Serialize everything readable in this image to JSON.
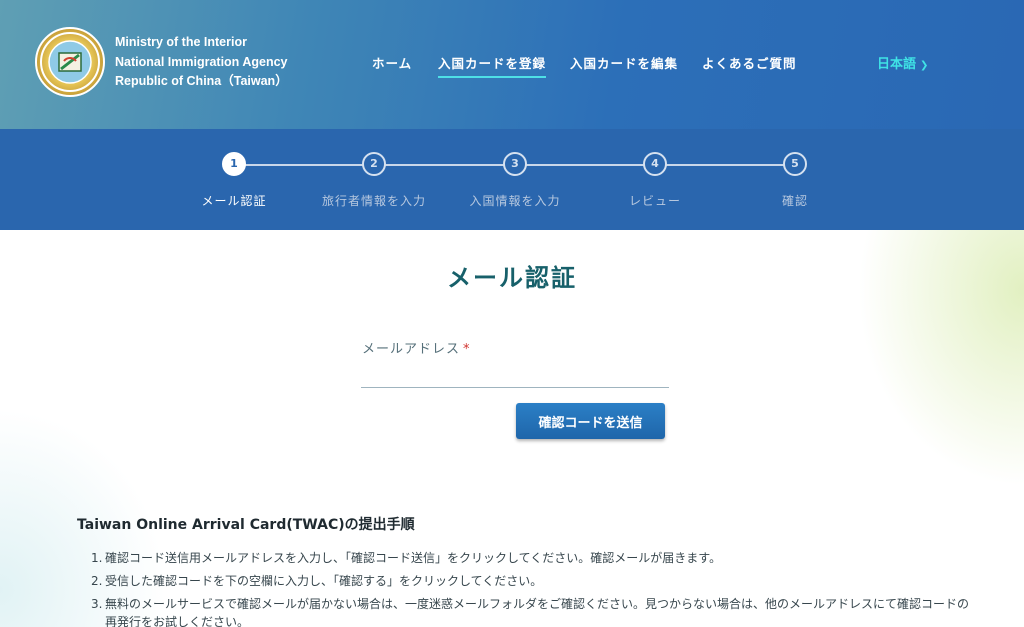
{
  "header": {
    "agency_lines": [
      "Ministry of the Interior",
      "National Immigration Agency",
      "Republic of China（Taiwan）"
    ],
    "nav": [
      {
        "label": "ホーム",
        "active": false
      },
      {
        "label": "入国カードを登録",
        "active": true
      },
      {
        "label": "入国カードを編集",
        "active": false
      },
      {
        "label": "よくあるご質問",
        "active": false
      }
    ],
    "language": "日本語"
  },
  "stepper": {
    "steps": [
      {
        "number": "1",
        "label": "メール認証",
        "active": true
      },
      {
        "number": "2",
        "label": "旅行者情報を入力",
        "active": false
      },
      {
        "number": "3",
        "label": "入国情報を入力",
        "active": false
      },
      {
        "number": "4",
        "label": "レビュー",
        "active": false
      },
      {
        "number": "5",
        "label": "確認",
        "active": false
      }
    ]
  },
  "main": {
    "title": "メール認証",
    "email_label": "メールアドレス",
    "required_mark": "*",
    "email_value": "",
    "send_button": "確認コードを送信",
    "procedure_title": "Taiwan Online Arrival Card(TWAC)の提出手順",
    "procedure": [
      {
        "num": "1.",
        "text": "確認コード送信用メールアドレスを入力し、「確認コード送信」をクリックしてください。確認メールが届きます。"
      },
      {
        "num": "2.",
        "text": "受信した確認コードを下の空欄に入力し、「確認する」をクリックしてください。"
      },
      {
        "num": "3.",
        "text": "無料のメールサービスで確認メールが届かない場合は、一度迷惑メールフォルダをご確認ください。見つからない場合は、他のメールアドレスにて確認コードの再発行をお試しください。"
      }
    ]
  },
  "colors": {
    "header_blue": "#2a68b4",
    "stepper_blue": "#2a66ae",
    "accent_cyan": "#3fe3e6",
    "title_teal": "#17606a",
    "button_blue": "#1f66aa"
  },
  "icons": {
    "logo": "national-immigration-agency-seal",
    "language_chevron": "chevron-down-icon"
  }
}
